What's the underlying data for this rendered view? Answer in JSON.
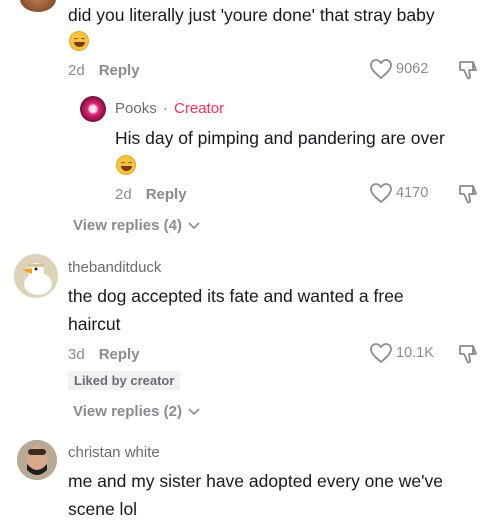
{
  "comments": [
    {
      "text": "did you literally just 'youre done' that stray baby",
      "age": "2d",
      "reply_label": "Reply",
      "likes": "9062",
      "reply": {
        "author": "Pooks",
        "separator": "·",
        "author_tag": "Creator",
        "text": "His day of pimping and pandering are over",
        "age": "2d",
        "reply_label": "Reply",
        "likes": "4170"
      },
      "view_replies": "View replies (4)"
    },
    {
      "author": "thebanditduck",
      "text_line1": "the dog accepted its fate and wanted a free",
      "text_line2": "haircut",
      "age": "3d",
      "reply_label": "Reply",
      "likes": "10.1K",
      "badge": "Liked by creator",
      "view_replies": "View replies (2)"
    },
    {
      "author": "christan white",
      "text_line1": "me and my sister have adopted every one we've",
      "text_line2": "scene lol"
    }
  ],
  "icons": {
    "like": "heart-outline-icon",
    "dislike": "thumbs-down-icon",
    "expand": "chevron-down-icon",
    "emoji": "grinning-face-emoji"
  },
  "colors": {
    "creator_tag": "#fe2c55",
    "text": "#161823",
    "muted": "#8a8b91"
  }
}
